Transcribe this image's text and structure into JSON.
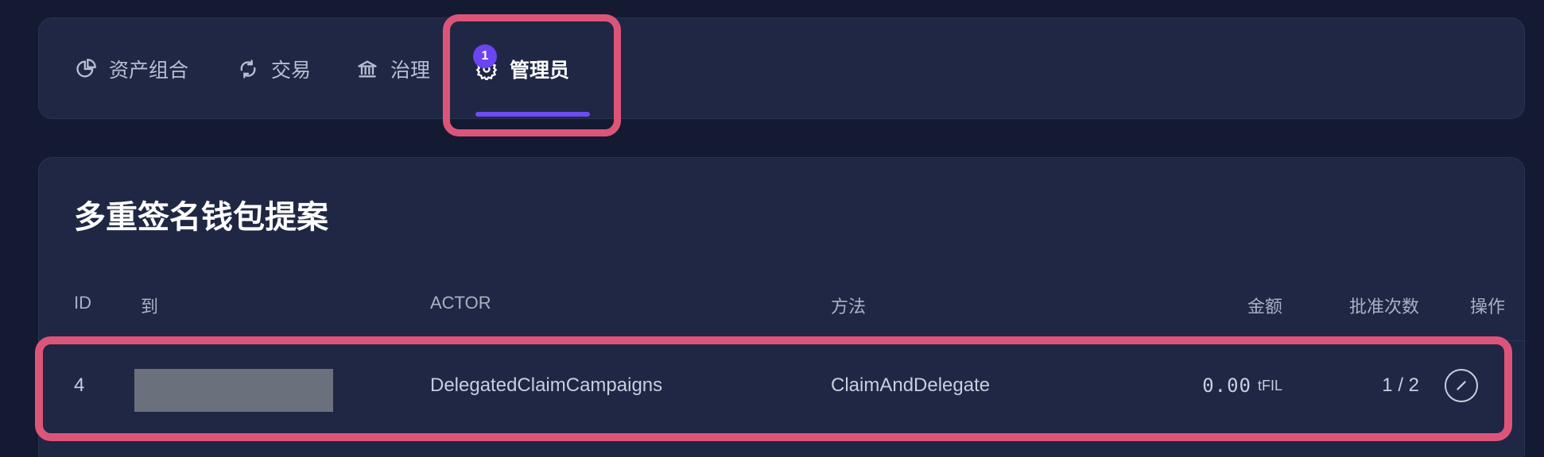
{
  "tabs": [
    {
      "label": "资产组合",
      "icon": "pie-chart-icon"
    },
    {
      "label": "交易",
      "icon": "refresh-icon"
    },
    {
      "label": "治理",
      "icon": "bank-icon"
    },
    {
      "label": "管理员",
      "icon": "gear-icon",
      "badge": "1",
      "active": true
    }
  ],
  "proposals": {
    "title": "多重签名钱包提案",
    "columns": {
      "id": "ID",
      "to": "到",
      "actor": "ACTOR",
      "method": "方法",
      "amount": "金额",
      "approvals": "批准次数",
      "actions": "操作"
    },
    "rows": [
      {
        "id": "4",
        "to": "",
        "actor": "DelegatedClaimCampaigns",
        "method": "ClaimAndDelegate",
        "amount": "0.00",
        "unit": "tFIL",
        "approvals": "1 / 2",
        "action_icon": "cancel-circle-icon"
      }
    ]
  },
  "colors": {
    "background": "#141a31",
    "card": "#1f2744",
    "accent": "#6d4cf2",
    "highlight": "#dc5579"
  }
}
